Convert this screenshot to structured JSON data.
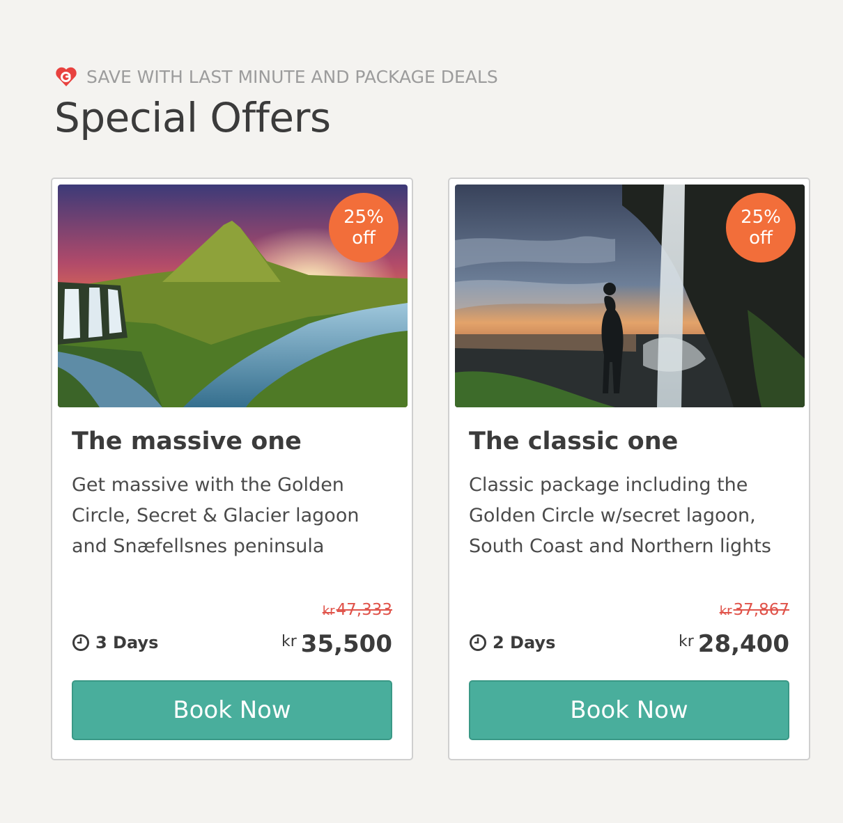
{
  "header": {
    "eyebrow": "SAVE WITH LAST MINUTE AND PACKAGE DEALS",
    "title": "Special Offers",
    "brand_icon": "guide-to-iceland-logo-icon",
    "brand_color": "#e8423f"
  },
  "colors": {
    "badge": "#f26e3a",
    "button": "#49ae9c",
    "old_price": "#e0534a",
    "background": "#f4f3f0"
  },
  "offers": [
    {
      "badge_pct": "25%",
      "badge_off": "off",
      "image": "kirkjufell-mountain-waterfall-sunset-photo",
      "title": "The massive one",
      "description": "Get massive with the Golden Circle, Secret & Glacier lagoon and Snæfellsnes peninsula",
      "old_price_currency": "kr",
      "old_price": "47,333",
      "duration_icon": "clock-icon",
      "duration": "3 Days",
      "price_currency": "kr",
      "price": "35,500",
      "button": "Book Now"
    },
    {
      "badge_pct": "25%",
      "badge_off": "off",
      "image": "seljalandsfoss-waterfall-hiker-sunset-photo",
      "title": "The classic one",
      "description": "Classic package including the Golden Circle w/secret lagoon, South Coast and Northern lights",
      "old_price_currency": "kr",
      "old_price": "37,867",
      "duration_icon": "clock-icon",
      "duration": "2 Days",
      "price_currency": "kr",
      "price": "28,400",
      "button": "Book Now"
    }
  ]
}
